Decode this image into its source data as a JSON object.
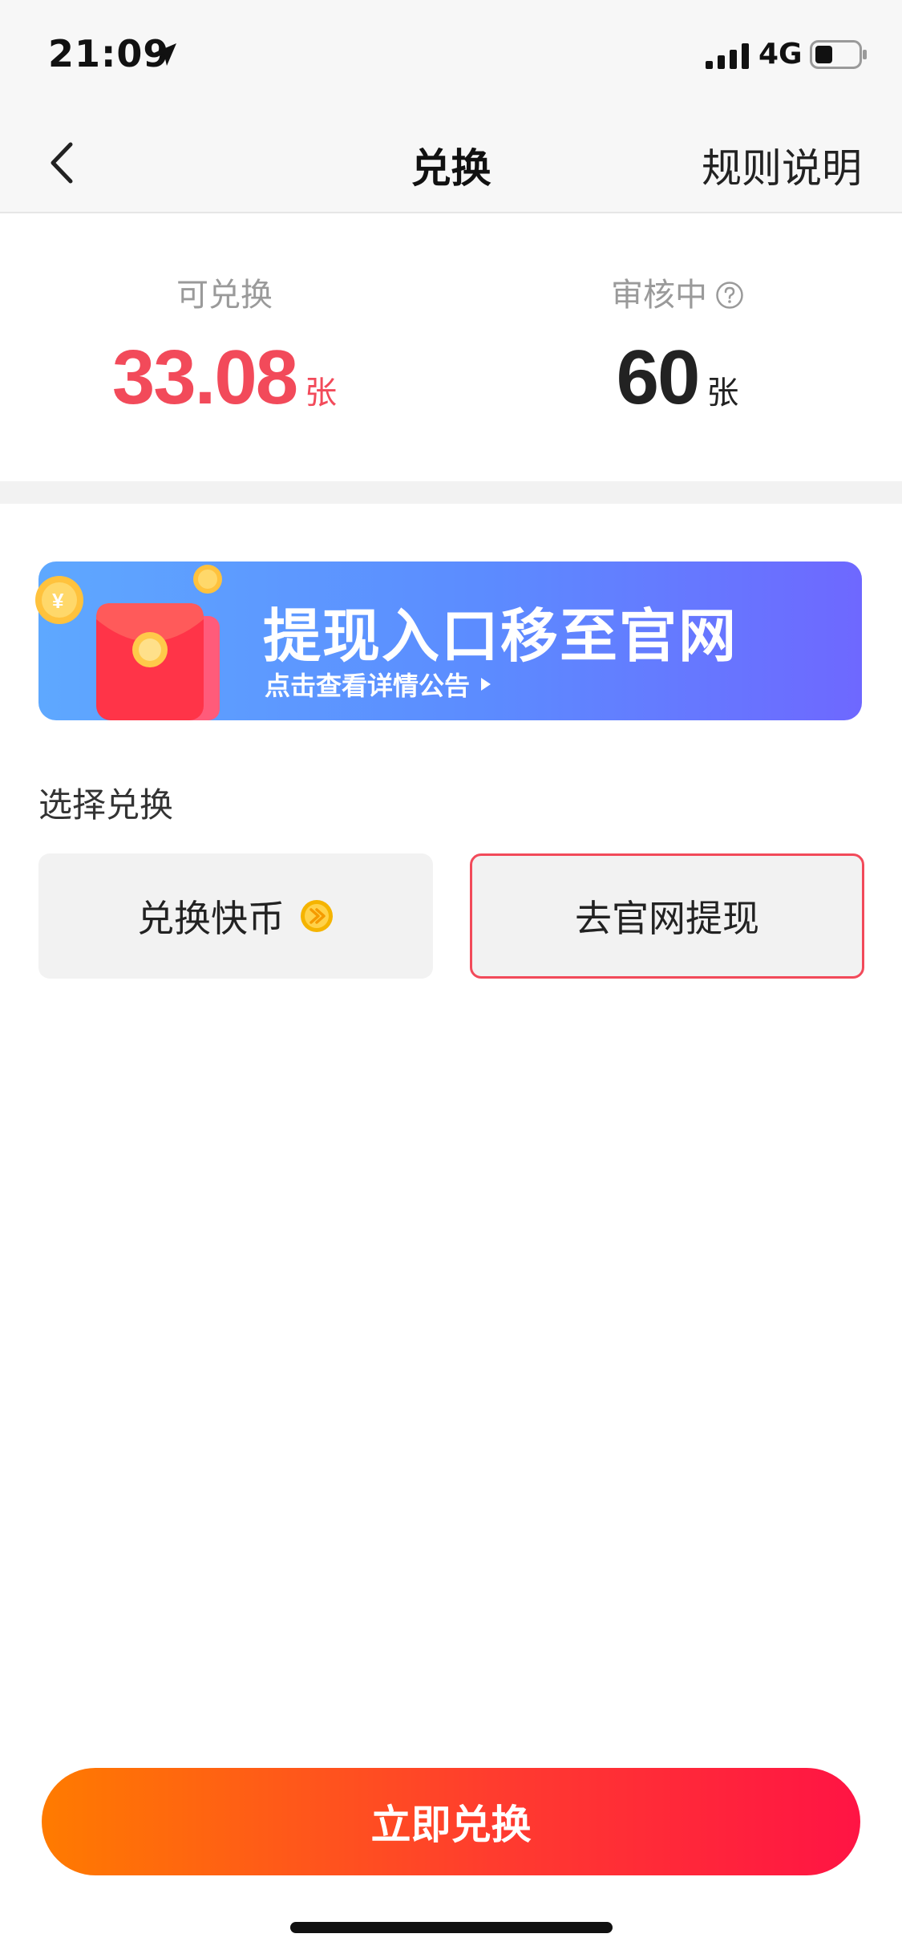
{
  "status_bar": {
    "time": "21:09",
    "network": "4G",
    "battery_percent": 40
  },
  "nav": {
    "title": "兑换",
    "rules_label": "规则说明"
  },
  "stats": {
    "available_label": "可兑换",
    "available_value": "33.08",
    "available_unit": "张",
    "reviewing_label": "审核中",
    "reviewing_value": "60",
    "reviewing_unit": "张"
  },
  "banner": {
    "title": "提现入口移至官网",
    "subtitle": "点击查看详情公告"
  },
  "options": {
    "section_title": "选择兑换",
    "coins_label": "兑换快币",
    "website_label": "去官网提现",
    "selected": "去官网提现"
  },
  "actions": {
    "redeem_label": "立即兑换"
  },
  "colors": {
    "accent_red": "#f24a5a",
    "button_start": "#ff7b00",
    "button_end": "#ff1444",
    "banner_start": "#5ea8ff",
    "banner_end": "#6e68ff"
  },
  "icons": [
    "location-arrow-icon",
    "signal-icon",
    "battery-icon",
    "back-icon",
    "help-icon",
    "red-packet-icon",
    "coin-icon",
    "arrow-right-icon"
  ]
}
